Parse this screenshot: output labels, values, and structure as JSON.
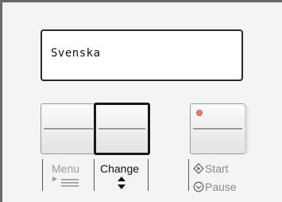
{
  "display": {
    "language": "Svenska"
  },
  "buttons": {
    "menu_label": "Menu",
    "change_label": "Change",
    "start_label": "Start",
    "pause_label": "Pause"
  },
  "icons": {
    "menu": "menu-list-icon",
    "change": "up-down-arrows-icon",
    "start": "start-diamond-icon",
    "pause": "pause-circle-icon"
  },
  "colors": {
    "led": "#e8826e",
    "selected_border": "#1a1a1a",
    "inactive_label": "#9a9a9a"
  }
}
